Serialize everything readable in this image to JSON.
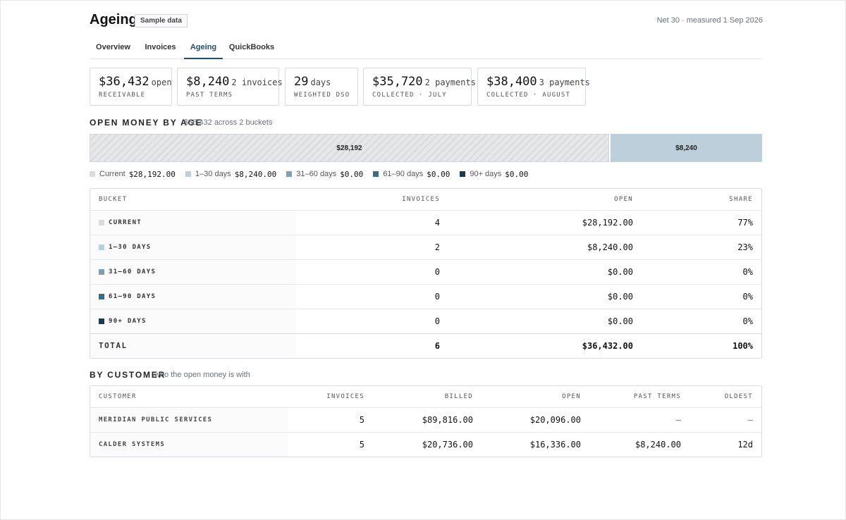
{
  "header": {
    "title": "Ageing",
    "badge": "Sample data",
    "meta": "Net 30 · measured 1 Sep 2026"
  },
  "tabs": [
    {
      "label": "Overview",
      "active": false
    },
    {
      "label": "Invoices",
      "active": false
    },
    {
      "label": "Ageing",
      "active": true
    },
    {
      "label": "QuickBooks",
      "active": false
    }
  ],
  "kpis": [
    {
      "value": "$36,432",
      "unit": "open",
      "label": "RECEIVABLE"
    },
    {
      "value": "$8,240",
      "unit": "2 invoices",
      "label": "PAST TERMS"
    },
    {
      "value": "29",
      "unit": "days",
      "label": "WEIGHTED DSO"
    },
    {
      "value": "$35,720",
      "unit": "2 payments",
      "label": "COLLECTED · JULY"
    },
    {
      "value": "$38,400",
      "unit": "3 payments",
      "label": "COLLECTED · AUGUST"
    }
  ],
  "age_section": {
    "title": "OPEN MONEY BY AGE",
    "subtitle": "$36,432 across 2 buckets",
    "bar": [
      {
        "label": "$28,192",
        "share": 0.7738
      },
      {
        "label": "$8,240",
        "share": 0.2262
      }
    ]
  },
  "legend": [
    {
      "label": "Current",
      "amount": "$28,192.00",
      "color": "#d9dbdd"
    },
    {
      "label": "1–30 days",
      "amount": "$8,240.00",
      "color": "#bccfdb"
    },
    {
      "label": "31–60 days",
      "amount": "$0.00",
      "color": "#7f9fb5"
    },
    {
      "label": "61–90 days",
      "amount": "$0.00",
      "color": "#3b6b8a"
    },
    {
      "label": "90+ days",
      "amount": "$0.00",
      "color": "#173a52"
    }
  ],
  "age_table": {
    "headers": {
      "bucket": "BUCKET",
      "invoices": "INVOICES",
      "open": "OPEN",
      "share": "SHARE"
    },
    "rows": [
      {
        "bucket": "CURRENT",
        "invoices": "4",
        "open": "$28,192.00",
        "share": "77%"
      },
      {
        "bucket": "1–30 DAYS",
        "invoices": "2",
        "open": "$8,240.00",
        "share": "23%"
      },
      {
        "bucket": "31–60 DAYS",
        "invoices": "0",
        "open": "$0.00",
        "share": "0%"
      },
      {
        "bucket": "61–90 DAYS",
        "invoices": "0",
        "open": "$0.00",
        "share": "0%"
      },
      {
        "bucket": "90+ DAYS",
        "invoices": "0",
        "open": "$0.00",
        "share": "0%"
      }
    ],
    "total": {
      "bucket": "TOTAL",
      "invoices": "6",
      "open": "$36,432.00",
      "share": "100%"
    }
  },
  "customer_section": {
    "title": "BY CUSTOMER",
    "subtitle": "who the open money is with"
  },
  "customer_table": {
    "headers": {
      "customer": "CUSTOMER",
      "invoices": "INVOICES",
      "billed": "BILLED",
      "open": "OPEN",
      "past_terms": "PAST TERMS",
      "oldest": "OLDEST"
    },
    "rows": [
      {
        "customer": "MERIDIAN PUBLIC SERVICES",
        "invoices": "5",
        "billed": "$89,816.00",
        "open": "$20,096.00",
        "past_terms": "—",
        "oldest": "—"
      },
      {
        "customer": "CALDER SYSTEMS",
        "invoices": "5",
        "billed": "$20,736.00",
        "open": "$16,336.00",
        "past_terms": "$8,240.00",
        "oldest": "12d"
      }
    ]
  }
}
